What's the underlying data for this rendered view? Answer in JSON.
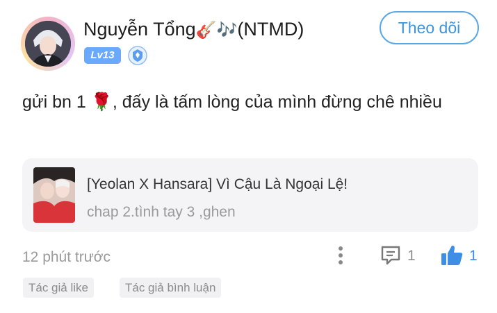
{
  "author": {
    "name": "Nguyễn Tổng",
    "name_emoji": "🎸🎶",
    "name_suffix": "(NTMD)",
    "level": "Lv13",
    "verify_icon": "shield-badge-icon"
  },
  "follow_label": "Theo dõi",
  "post": {
    "text_before_emoji": "gửi bn 1",
    "emoji": "🌹",
    "text_after_emoji": ", đấy là tấm lòng của mình đừng chê nhiều"
  },
  "shared_story": {
    "title": "[Yeolan X Hansara] Vì Cậu Là Ngoại Lệ!",
    "subtitle": "chap 2.tình tay 3 ,ghen"
  },
  "meta": {
    "time": "12 phút trước",
    "comment_count": "1",
    "like_count": "1"
  },
  "tags": [
    "Tác giả like",
    "Tác giả bình luận"
  ],
  "colors": {
    "accent": "#3b94dc",
    "like_blue": "#3e8ee6",
    "level_badge": "#69a9ff",
    "muted_text": "#9a9a9a",
    "card_bg": "#f4f4f6"
  }
}
